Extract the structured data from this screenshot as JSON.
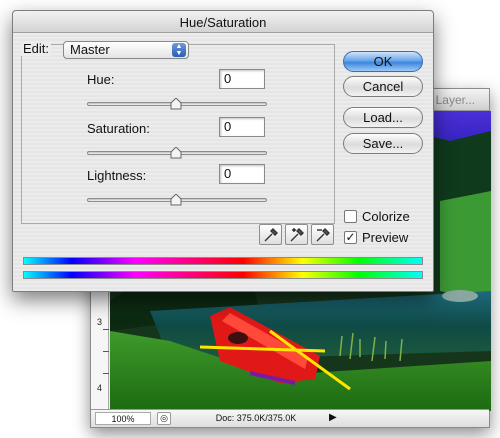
{
  "document_window": {
    "title": ", Layer...",
    "ruler_marks": [
      "3",
      "4"
    ],
    "status": {
      "zoom": "100%",
      "doc_size": "Doc: 375.0K/375.0K",
      "arrow": "▶"
    }
  },
  "dialog": {
    "title": "Hue/Saturation",
    "edit_label": "Edit:",
    "edit_value": "Master",
    "hue_label": "Hue:",
    "hue_value": "0",
    "saturation_label": "Saturation:",
    "saturation_value": "0",
    "lightness_label": "Lightness:",
    "lightness_value": "0",
    "buttons": {
      "ok": "OK",
      "cancel": "Cancel",
      "load": "Load...",
      "save": "Save..."
    },
    "colorize_label": "Colorize",
    "colorize_checked": false,
    "preview_label": "Preview",
    "preview_checked": true,
    "preview_check_glyph": "✓"
  },
  "colors": {
    "ok_button_accent": "#3d86dd",
    "spectrum": [
      "#00ffff",
      "#0000ff",
      "#ff00ff",
      "#ff0000",
      "#ffff00",
      "#00ff00",
      "#00ffff"
    ]
  }
}
